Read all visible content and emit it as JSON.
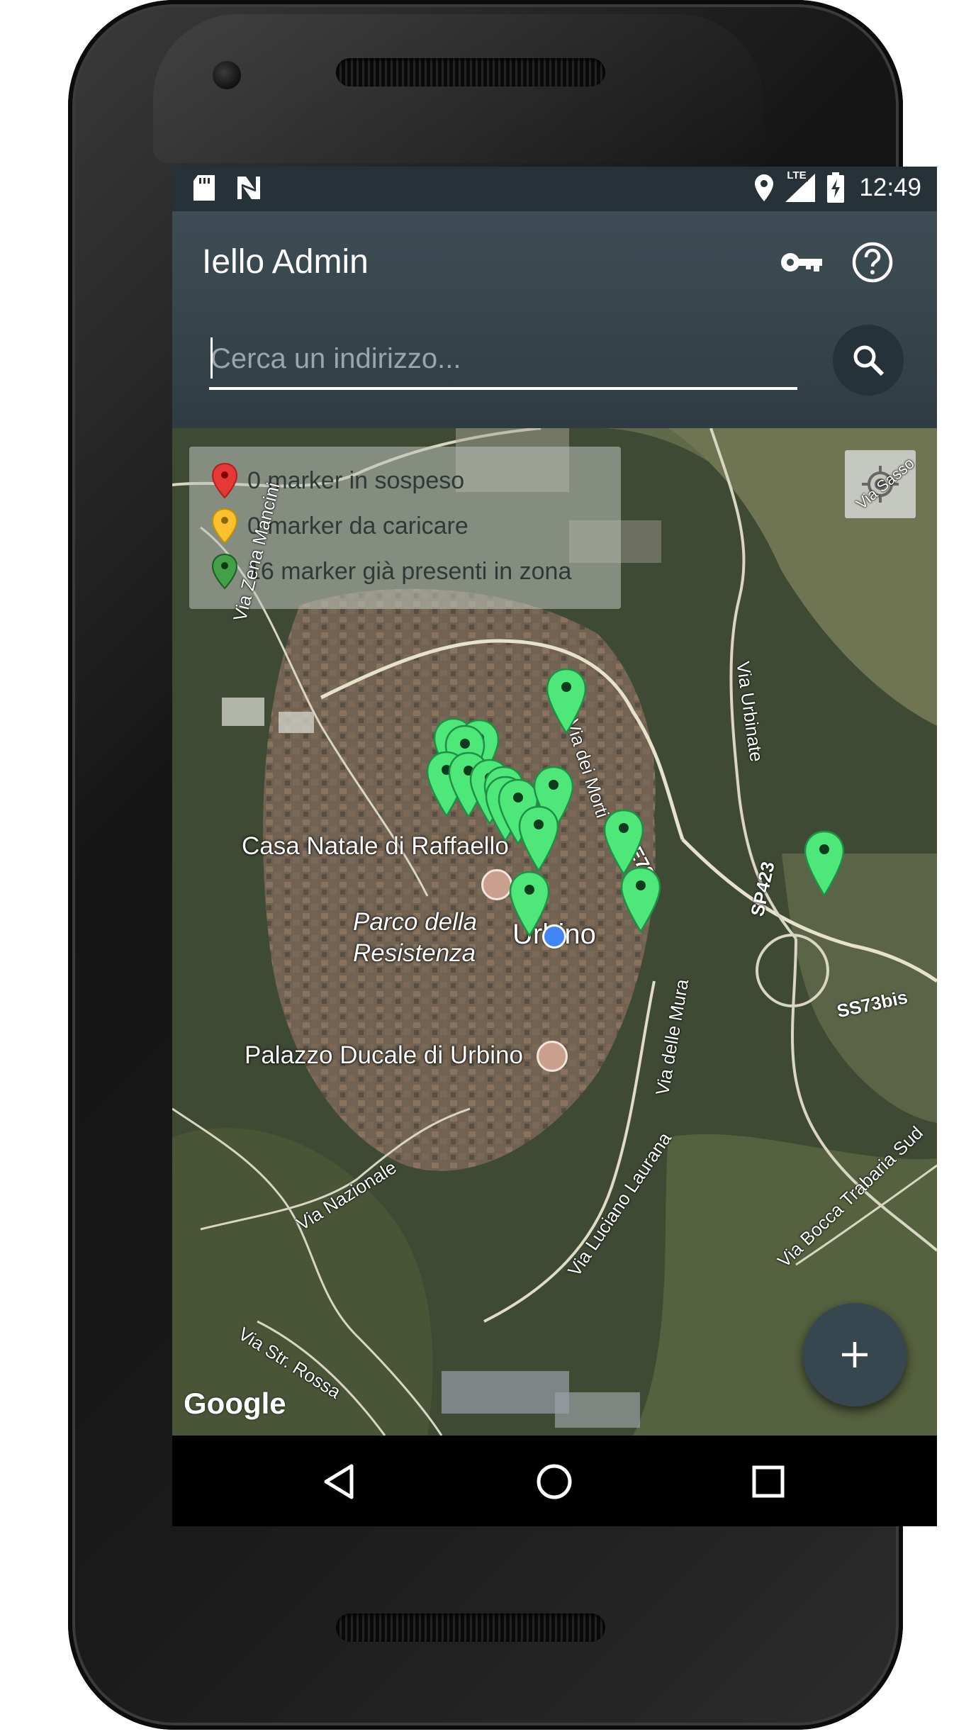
{
  "status_bar": {
    "time": "12:49",
    "network": "LTE",
    "icons": [
      "sd-card-icon",
      "n-notification-icon",
      "location-icon",
      "signal-icon",
      "battery-charging-icon"
    ]
  },
  "app_bar": {
    "title": "Iello Admin",
    "key_icon": "key-icon",
    "help_icon": "help-icon"
  },
  "search": {
    "placeholder": "Cerca un indirizzo...",
    "value": "",
    "button_icon": "search-icon"
  },
  "legend": {
    "items": [
      {
        "label": "0 marker in sospeso",
        "color": "#e53935"
      },
      {
        "label": "0 marker da caricare",
        "color": "#fbc02d"
      },
      {
        "label": "16 marker già presenti in zona",
        "color": "#43a047"
      }
    ]
  },
  "map": {
    "places": [
      "Casa Natale di Raffaello",
      "Parco della",
      "Resistenza",
      "Urbino",
      "Palazzo Ducale di Urbino"
    ],
    "roads": [
      "Via Zena Mancini",
      "Via dei Morti",
      "Via Urbinate",
      "E78",
      "SP423",
      "SS73bis",
      "Via delle Mura",
      "Via Luciano Laurana",
      "Via Bocca Trabaria Sud",
      "Via Nazionale",
      "Via Str. Rossa",
      "Via Sasso"
    ],
    "attribution": "Google",
    "marker_color": "#4ee87a",
    "marker_count": 16
  },
  "fab": {
    "label": "+",
    "icon": "add-icon"
  },
  "nav_bar": {
    "back_icon": "back-icon",
    "home_icon": "home-icon",
    "recents_icon": "recents-icon"
  }
}
